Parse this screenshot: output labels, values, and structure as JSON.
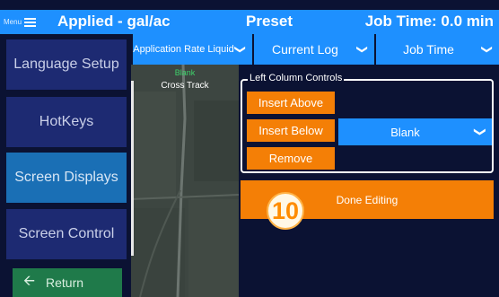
{
  "header": {
    "menu_label": "Menu",
    "applied": "Applied - gal/ac",
    "preset": "Preset",
    "job_time": "Job Time: 0.0 min"
  },
  "sidebar": {
    "items": [
      {
        "label": "Language Setup",
        "active": false
      },
      {
        "label": "HotKeys",
        "active": false
      },
      {
        "label": "Screen Displays",
        "active": true
      },
      {
        "label": "Screen Control",
        "active": false
      }
    ],
    "return_label": "Return"
  },
  "dropdowns": {
    "app_rate": "Application Rate Liquid",
    "current_log": "Current Log",
    "job_time": "Job Time"
  },
  "map": {
    "blank": "Blank",
    "cross_track": "Cross Track"
  },
  "controls": {
    "title": "Left Column Controls",
    "insert_above": "Insert Above",
    "insert_below": "Insert Below",
    "remove": "Remove",
    "selected": "Blank"
  },
  "done": {
    "label": "Done Editing",
    "badge": "10"
  },
  "colors": {
    "accent": "#1e90ff",
    "orange": "#f47f06",
    "sidebar": "#1d2a72",
    "sidebar_active": "#1a6fb5",
    "return_green": "#1f7a4a"
  }
}
